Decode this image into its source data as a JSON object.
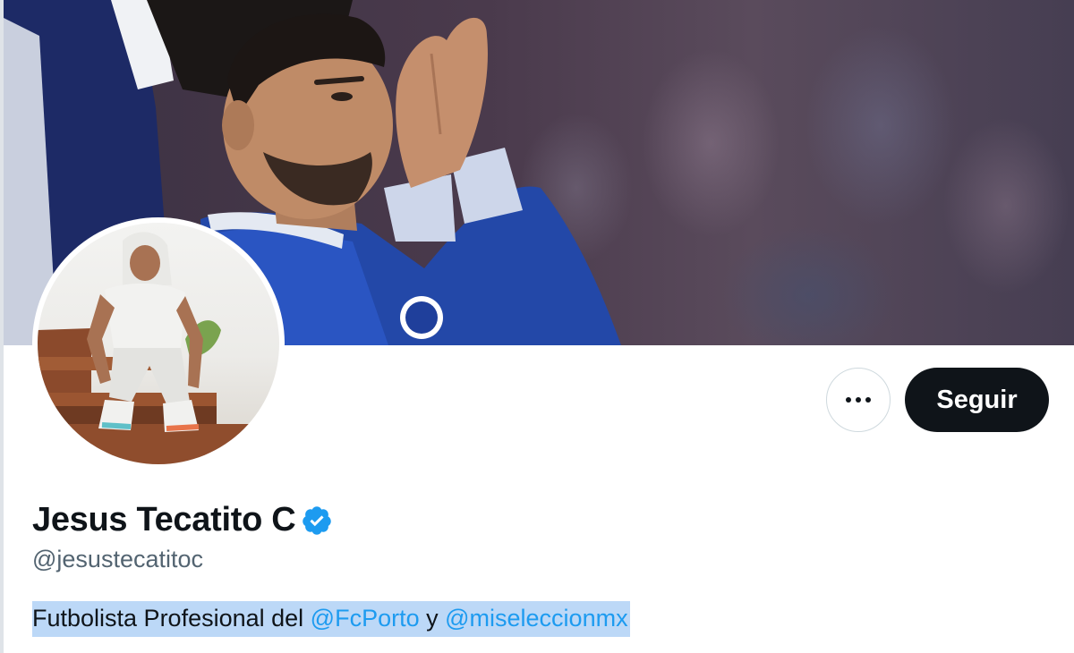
{
  "profile": {
    "display_name": "Jesus Tecatito C",
    "handle": "@jesustecatitoc",
    "verified": true,
    "bio": {
      "text_1": "Futbolista Profesional del ",
      "mention_1": "@FcPorto",
      "text_2": " y ",
      "mention_2": "@miseleccionmx"
    }
  },
  "actions": {
    "more_icon": "more-horizontal-icon",
    "follow_label": "Seguir"
  },
  "colors": {
    "accent": "#1d9bf0",
    "follow_bg": "#0f1419",
    "selection_highlight": "#bcd8f7",
    "secondary_text": "#536471"
  }
}
